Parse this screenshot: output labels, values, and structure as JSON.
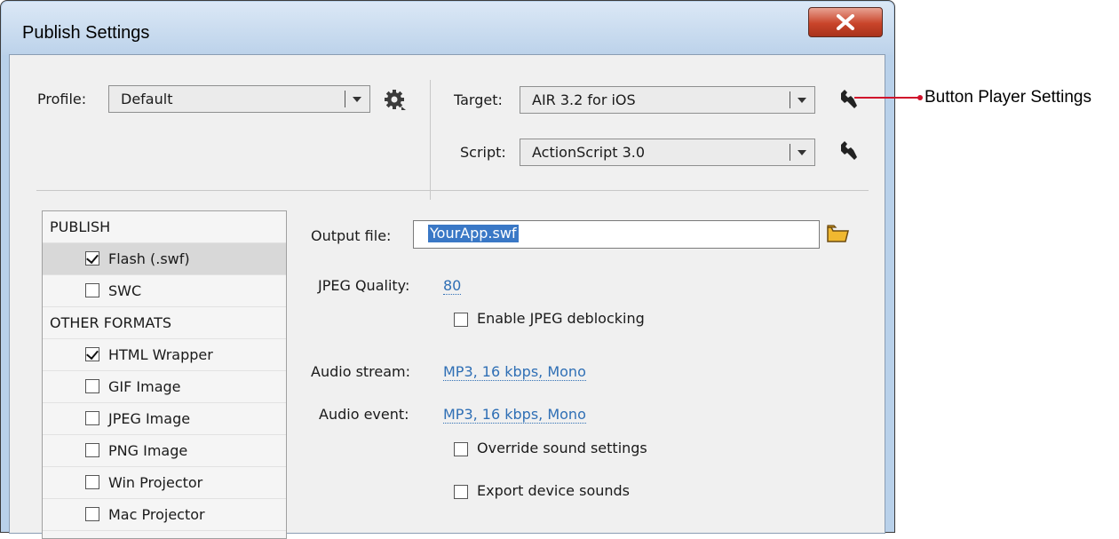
{
  "window": {
    "title": "Publish Settings"
  },
  "profile": {
    "label": "Profile:",
    "value": "Default"
  },
  "target": {
    "label": "Target:",
    "value": "AIR 3.2 for iOS"
  },
  "script": {
    "label": "Script:",
    "value": "ActionScript 3.0"
  },
  "formats": {
    "publish_header": "PUBLISH",
    "other_header": "OTHER FORMATS",
    "items": [
      {
        "label": "Flash (.swf)",
        "checked": true
      },
      {
        "label": "SWC",
        "checked": false
      },
      {
        "label": "HTML Wrapper",
        "checked": true
      },
      {
        "label": "GIF Image",
        "checked": false
      },
      {
        "label": "JPEG Image",
        "checked": false
      },
      {
        "label": "PNG Image",
        "checked": false
      },
      {
        "label": "Win Projector",
        "checked": false
      },
      {
        "label": "Mac Projector",
        "checked": false
      }
    ]
  },
  "settings": {
    "output_file_label": "Output file:",
    "output_file_value": "YourApp.swf",
    "jpeg_quality_label": "JPEG Quality:",
    "jpeg_quality_value": "80",
    "enable_jpeg_deblocking": "Enable JPEG deblocking",
    "audio_stream_label": "Audio stream:",
    "audio_stream_value": "MP3, 16 kbps, Mono",
    "audio_event_label": "Audio event:",
    "audio_event_value": "MP3, 16 kbps, Mono",
    "override_sound": "Override sound settings",
    "export_device_sounds": "Export device sounds"
  },
  "callout": {
    "text": "Button Player Settings",
    "color": "#d0112b"
  },
  "icons": {
    "gear": "gear-icon",
    "wrench": "wrench-icon",
    "folder": "folder-icon",
    "close": "close-icon"
  }
}
